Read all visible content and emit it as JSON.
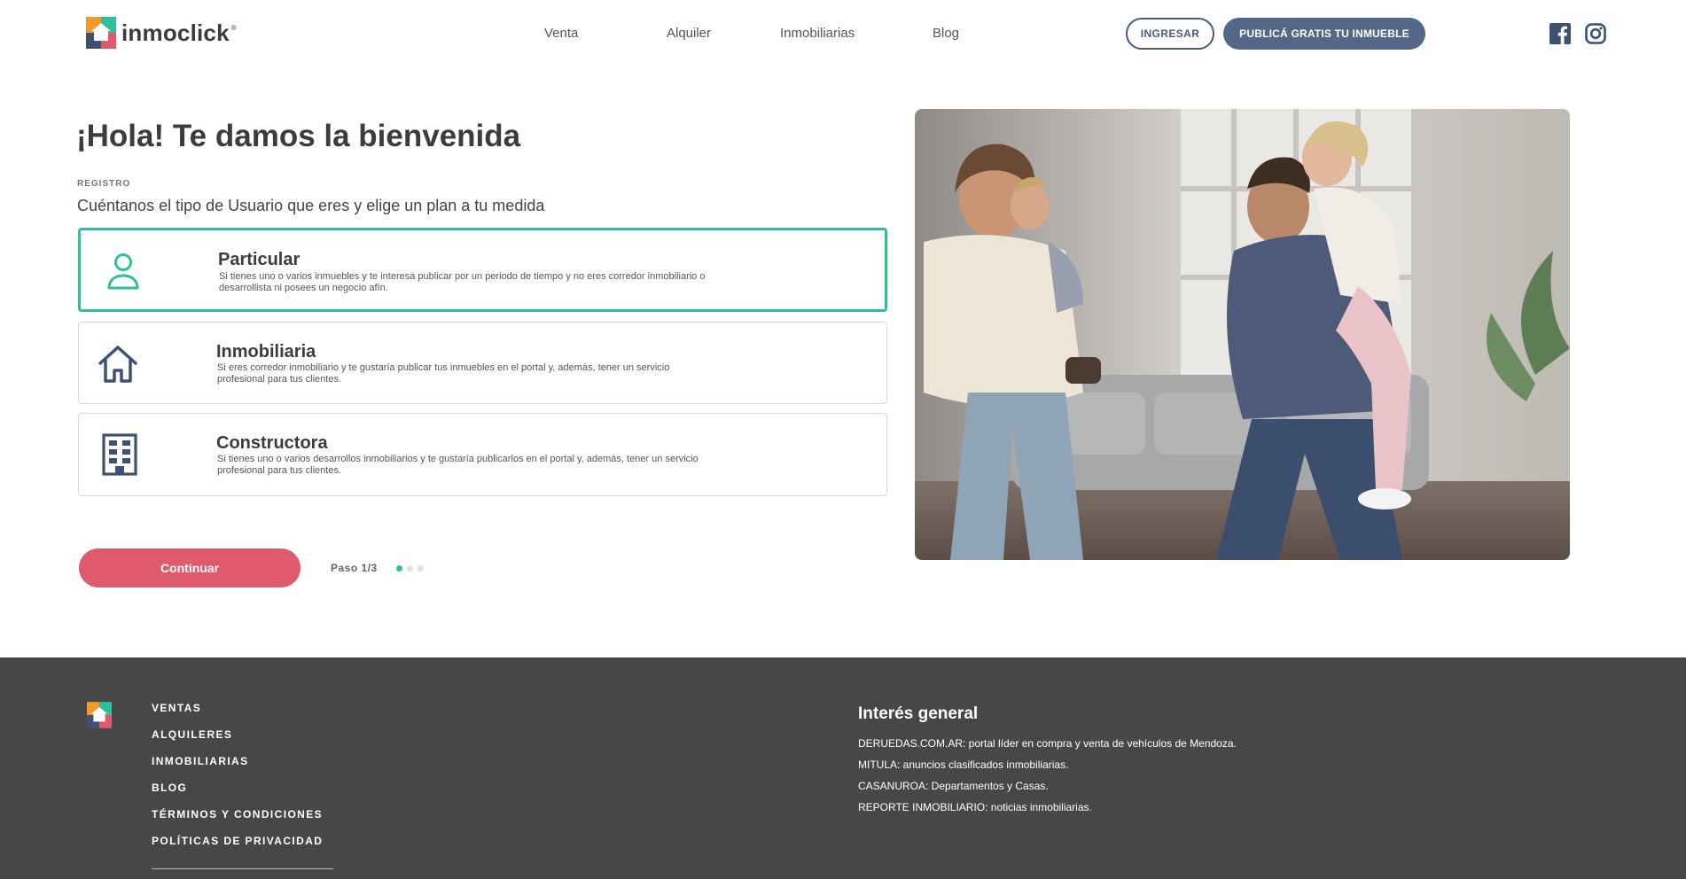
{
  "header": {
    "brand": "inmoclick",
    "nav": [
      "Venta",
      "Alquiler",
      "Inmobiliarias",
      "Blog"
    ],
    "login_label": "INGRESAR",
    "publish_label": "PUBLICÁ GRATIS TU INMUEBLE"
  },
  "main": {
    "title": "¡Hola! Te damos la bienvenida",
    "step_label": "REGISTRO",
    "subtitle": "Cuéntanos el tipo de Usuario que eres y elige un plan a tu medida",
    "options": [
      {
        "title": "Particular",
        "desc_line1": "Si tienes uno o varios inmuebles y te interesa publicar por un periodo de tiempo y no eres corredor inmobiliario o",
        "desc_line2": "desarrollista ni posees un negocio afín.",
        "icon": "person-icon",
        "selected": true
      },
      {
        "title": "Inmobiliaria",
        "desc_line1": "Si eres corredor inmobiliario y te gustaría publicar tus inmuebles en el portal y, además, tener un servicio",
        "desc_line2": "profesional para tus clientes.",
        "icon": "house-icon",
        "selected": false
      },
      {
        "title": "Constructora",
        "desc_line1": "Si tienes uno o varios desarrollos inmobiliarios y te gustaría publicarlos en el portal y, además, tener un servicio",
        "desc_line2": "profesional para tus clientes.",
        "icon": "building-icon",
        "selected": false
      }
    ],
    "continue_label": "Continuar",
    "step_indicator": "Paso 1/3",
    "current_step": 1,
    "total_steps": 3
  },
  "footer": {
    "links": [
      "VENTAS",
      "ALQUILERES",
      "INMOBILIARIAS",
      "BLOG",
      "TÉRMINOS Y CONDICIONES",
      "POLÍTICAS DE PRIVACIDAD"
    ],
    "interest_title": "Interés general",
    "interest_items": [
      "DERUEDAS.COM.AR: portal líder en compra y venta de vehículos de Mendoza.",
      "MITULA: anuncios clasificados inmobiliarias.",
      "CASANUROA: Departamentos y Casas.",
      "REPORTE INMOBILIARIO: noticias inmobiliarias."
    ]
  },
  "colors": {
    "accent_green": "#2fbf9b",
    "primary_navy": "#556787",
    "cta_pink": "#e05a6e",
    "footer_bg": "#474747",
    "icon_navy": "#3f5170"
  }
}
